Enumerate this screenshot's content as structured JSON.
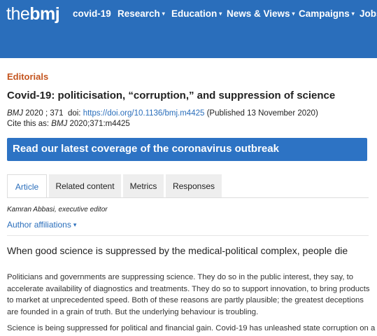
{
  "header": {
    "logo_the": "the",
    "logo_bmj": "bmj",
    "nav": [
      {
        "label": "covid-19",
        "has_menu": false
      },
      {
        "label": "Research",
        "has_menu": true
      },
      {
        "label": "Education",
        "has_menu": true
      },
      {
        "label": "News & Views",
        "has_menu": true
      },
      {
        "label": "Campaigns",
        "has_menu": true
      },
      {
        "label": "Jobs",
        "has_menu": false
      }
    ],
    "chevron_glyph": "▾",
    "bar_color": "#2a6ebb"
  },
  "article": {
    "section": "Editorials",
    "title": "Covid-19: politicisation, “corruption,” and suppression of science",
    "citation": {
      "journal": "BMJ",
      "year_volume": "2020 ; 371",
      "doi_label": "doi:",
      "doi": "https://doi.org/10.1136/bmj.m4425",
      "published": "(Published 13 November 2020)",
      "cite_prefix": "Cite this as:",
      "cite_journal": "BMJ",
      "cite_ref": "2020;371:m4425"
    },
    "banner": "Read our latest coverage of the coronavirus outbreak",
    "tabs": [
      {
        "label": "Article",
        "active": true
      },
      {
        "label": "Related content",
        "active": false
      },
      {
        "label": "Metrics",
        "active": false
      },
      {
        "label": "Responses",
        "active": false
      }
    ],
    "author": "Kamran Abbasi, executive editor",
    "affiliations_label": "Author affiliations",
    "standfirst": "When good science is suppressed by the medical-political complex, people die",
    "paragraphs": [
      "Politicians and governments are suppressing science. They do so in the public interest, they say, to accelerate availability of diagnostics and treatments. They do so to support innovation, to bring products to market at unprecedented speed. Both of these reasons are partly plausible; the greatest deceptions are founded in a grain of truth. But the underlying behaviour is troubling.",
      "Science is being suppressed for political and financial gain. Covid-19 has unleashed state corruption on a"
    ]
  },
  "colors": {
    "accent": "#2a6ebb",
    "section_label": "#c4551f",
    "banner": "#2d73c4"
  }
}
